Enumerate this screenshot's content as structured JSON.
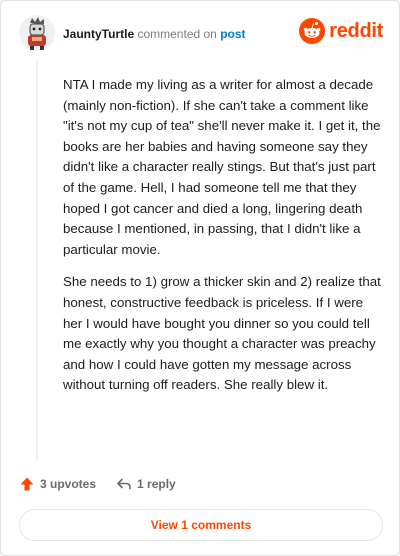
{
  "comment": {
    "author": "JauntyTurtle",
    "action_text": "commented on",
    "post_link_label": "post",
    "paragraphs": [
      "NTA I made my living as a writer for almost a decade (mainly non-fiction). If she can't take a comment like \"it's not my cup of tea\" she'll never make it. I get it, the books are her babies and having someone say they didn't like a character really stings. But that's just part of the game. Hell, I had someone tell me that they hoped I got cancer and died a long, lingering death because I mentioned, in passing, that I didn't like a particular movie.",
      "She needs to 1) grow a thicker skin and 2) realize that honest, constructive feedback is priceless. If I were her I would have bought you dinner so you could tell me exactly why you thought a character was preachy and how I could have gotten my message across without turning off readers. She really blew it."
    ]
  },
  "brand": {
    "wordmark": "reddit",
    "color": "#ff4500"
  },
  "actions": {
    "upvotes_label": "3 upvotes",
    "upvote_icon": "arrow-up-icon",
    "replies_label": "1 reply",
    "reply_icon": "reply-arrow-icon"
  },
  "footer": {
    "view_comments_label": "View 1 comments"
  },
  "colors": {
    "accent": "#ff4500",
    "link": "#0079d3",
    "muted": "#7c7c7c"
  }
}
